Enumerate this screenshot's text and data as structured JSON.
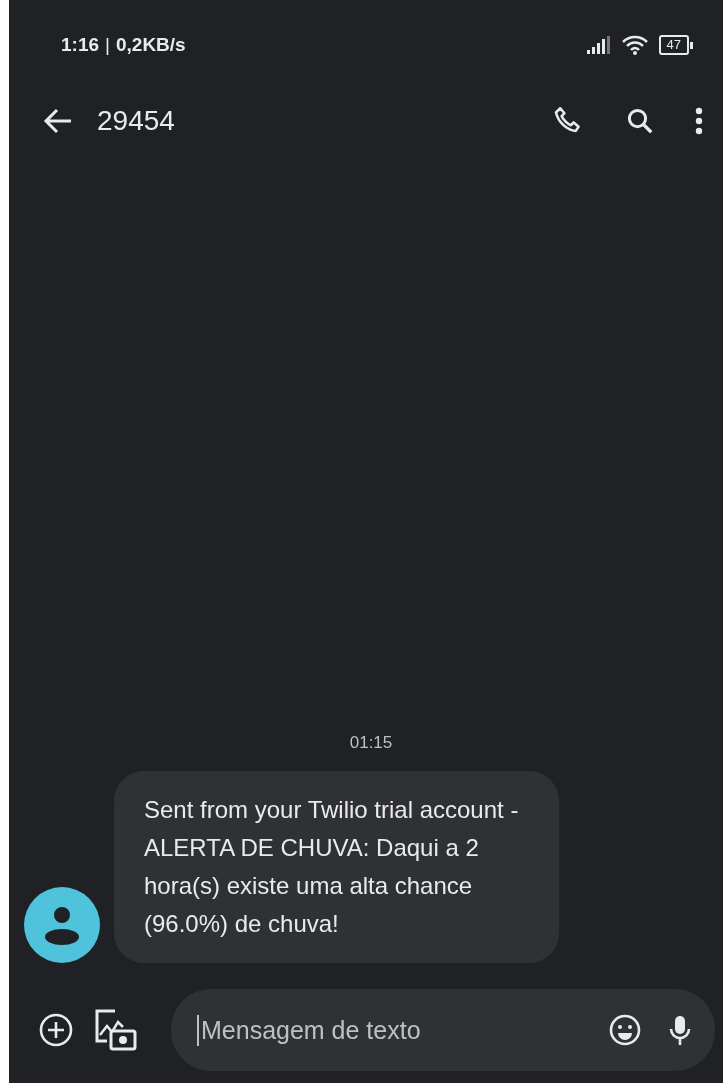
{
  "status_bar": {
    "time": "1:16",
    "separator": "|",
    "speed": "0,2KB/s",
    "battery": "47"
  },
  "header": {
    "title": "29454"
  },
  "conversation": {
    "timestamp": "01:15",
    "messages": [
      {
        "text": "Sent from your Twilio trial account - ALERTA DE CHUVA: Daqui a 2 hora(s) existe uma alta chance (96.0%) de chuva!"
      }
    ]
  },
  "composer": {
    "placeholder": "Mensagem de texto"
  }
}
